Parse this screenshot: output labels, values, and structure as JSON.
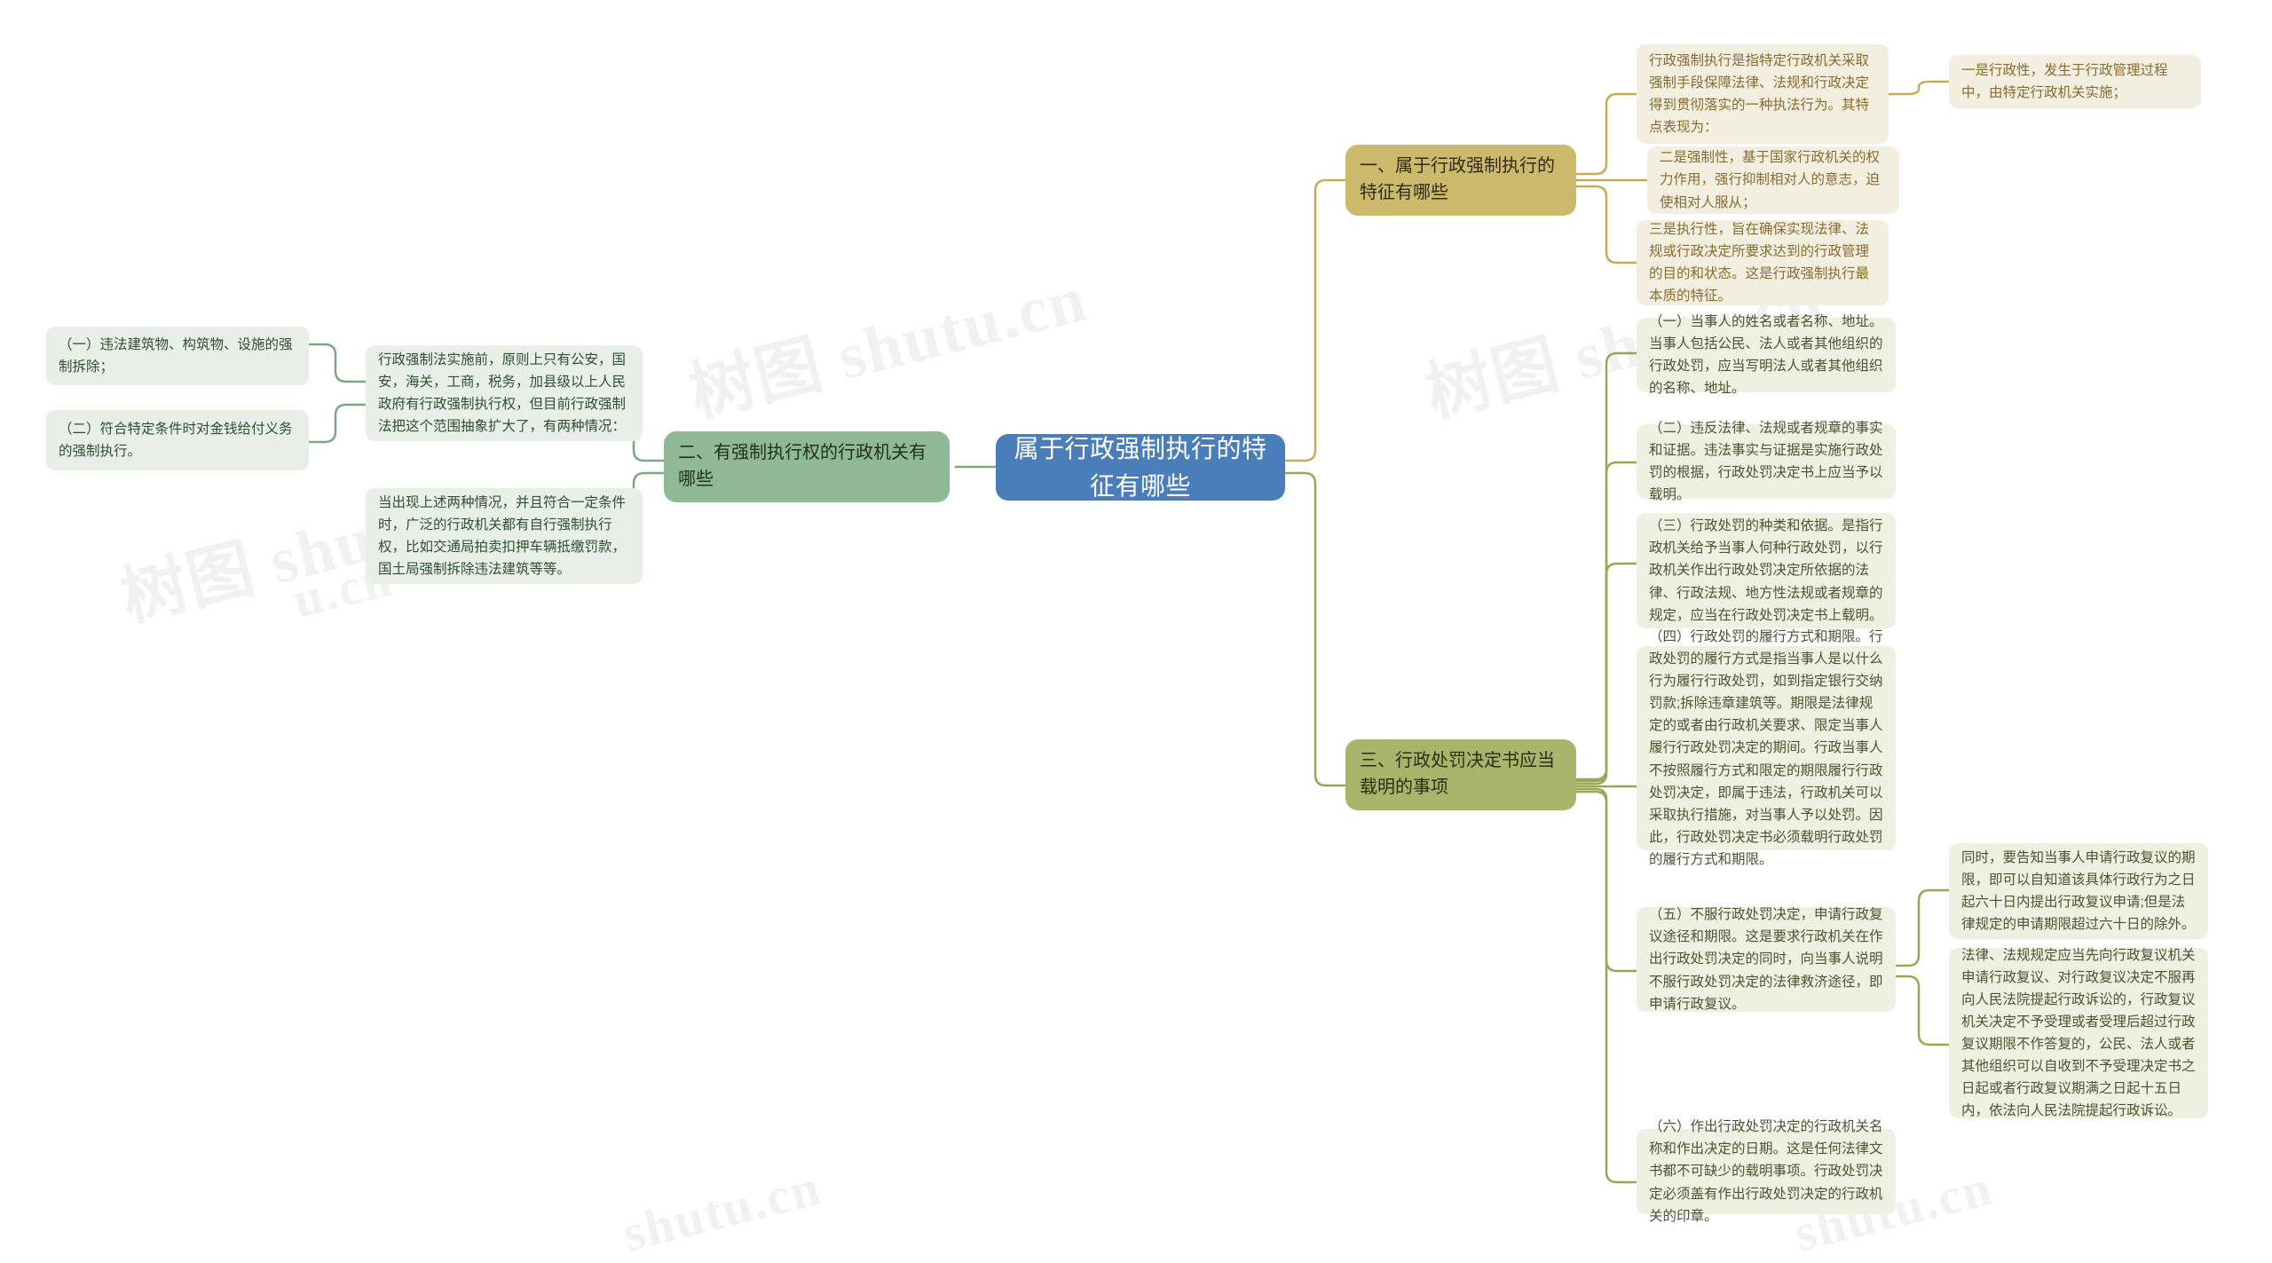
{
  "meta": {
    "colors": {
      "root_bg": "#4a7ebb",
      "branch1_bg": "#cdb96a",
      "branch2_bg": "#8fb995",
      "branch3_bg": "#a8b46a",
      "leaf_tan_bg": "#f2efe0",
      "leaf_green_bg": "#e7efe7",
      "leaf_olive_bg": "#eef0e2",
      "canvas_bg": "#ffffff"
    }
  },
  "root": {
    "label": "属于行政强制执行的特征有哪些"
  },
  "watermarks": [
    {
      "text": "树图 shutu.cn"
    },
    {
      "text": "树图 shutu.cn"
    },
    {
      "text": "树图 shutu.cn"
    },
    {
      "text": "shutu.cn"
    },
    {
      "text": "shutu.cn"
    },
    {
      "text": "u.cn"
    }
  ],
  "branches": [
    {
      "id": "branch-1",
      "label": "一、属于行政强制执行的特征有哪些",
      "side": "right",
      "children": [
        {
          "id": "b1-c1",
          "text": "行政强制执行是指特定行政机关采取强制手段保障法律、法规和行政决定得到贯彻落实的一种执法行为。其特点表现为：",
          "children": [
            {
              "id": "b1-c1-g1",
              "text": "一是行政性，发生于行政管理过程中，由特定行政机关实施；"
            }
          ]
        },
        {
          "id": "b1-c2",
          "text": "二是强制性，基于国家行政机关的权力作用，强行抑制相对人的意志，迫使相对人服从；",
          "children": []
        },
        {
          "id": "b1-c3",
          "text": "三是执行性，旨在确保实现法律、法规或行政决定所要求达到的行政管理的目的和状态。这是行政强制执行最本质的特征。",
          "children": []
        }
      ]
    },
    {
      "id": "branch-2",
      "label": "二、有强制执行权的行政机关有哪些",
      "side": "left",
      "children": [
        {
          "id": "b2-c1",
          "text": "行政强制法实施前，原则上只有公安，国安，海关，工商，税务，加县级以上人民政府有行政强制执行权，但目前行政强制法把这个范围抽象扩大了，有两种情况：",
          "children": [
            {
              "id": "b2-c1-g1",
              "text": "（一）违法建筑物、构筑物、设施的强制拆除；"
            },
            {
              "id": "b2-c1-g2",
              "text": "（二）符合特定条件时对金钱给付义务的强制执行。"
            }
          ]
        },
        {
          "id": "b2-c2",
          "text": "当出现上述两种情况，并且符合一定条件时，广泛的行政机关都有自行强制执行权，比如交通局拍卖扣押车辆抵缴罚款，国土局强制拆除违法建筑等等。",
          "children": []
        }
      ]
    },
    {
      "id": "branch-3",
      "label": "三、行政处罚决定书应当载明的事项",
      "side": "right",
      "children": [
        {
          "id": "b3-c1",
          "text": "（一）当事人的姓名或者名称、地址。当事人包括公民、法人或者其他组织的行政处罚，应当写明法人或者其他组织的名称、地址。",
          "children": []
        },
        {
          "id": "b3-c2",
          "text": "（二）违反法律、法规或者规章的事实和证据。违法事实与证据是实施行政处罚的根据，行政处罚决定书上应当予以载明。",
          "children": []
        },
        {
          "id": "b3-c3",
          "text": "（三）行政处罚的种类和依据。是指行政机关给予当事人何种行政处罚，以行政机关作出行政处罚决定所依据的法律、行政法规、地方性法规或者规章的规定，应当在行政处罚决定书上载明。",
          "children": []
        },
        {
          "id": "b3-c4",
          "text": "（四）行政处罚的履行方式和期限。行政处罚的履行方式是指当事人是以什么行为履行行政处罚，如到指定银行交纳罚款;拆除违章建筑等。期限是法律规定的或者由行政机关要求、限定当事人履行行政处罚决定的期间。行政当事人不按照履行方式和限定的期限履行行政处罚决定，即属于违法，行政机关可以采取执行措施，对当事人予以处罚。因此，行政处罚决定书必须载明行政处罚的履行方式和期限。",
          "children": []
        },
        {
          "id": "b3-c5",
          "text": "（五）不服行政处罚决定，申请行政复议途径和期限。这是要求行政机关在作出行政处罚决定的同时，向当事人说明不服行政处罚决定的法律救济途径，即申请行政复议。",
          "children": [
            {
              "id": "b3-c5-g1",
              "text": "同时，要告知当事人申请行政复议的期限，即可以自知道该具体行政行为之日起六十日内提出行政复议申请;但是法律规定的申请期限超过六十日的除外。"
            },
            {
              "id": "b3-c5-g2",
              "text": "法律、法规规定应当先向行政复议机关申请行政复议、对行政复议决定不服再向人民法院提起行政诉讼的，行政复议机关决定不予受理或者受理后超过行政复议期限不作答复的，公民、法人或者其他组织可以自收到不予受理决定书之日起或者行政复议期满之日起十五日内，依法向人民法院提起行政诉讼。"
            }
          ]
        },
        {
          "id": "b3-c6",
          "text": "（六）作出行政处罚决定的行政机关名称和作出决定的日期。这是任何法律文书都不可缺少的载明事项。行政处罚决定必须盖有作出行政处罚决定的行政机关的印章。",
          "children": []
        }
      ]
    }
  ]
}
